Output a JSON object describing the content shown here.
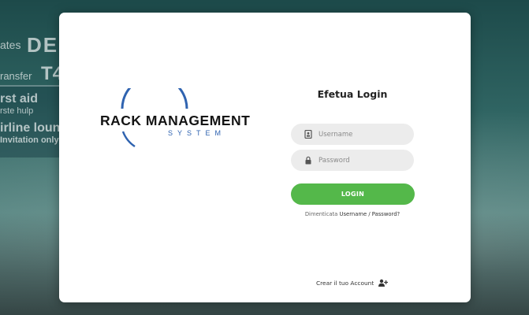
{
  "background": {
    "signs": [
      "ates",
      "DE",
      "ransfer",
      "T4",
      "rst aid",
      "rste hulp",
      "irline loun",
      "Invitation only"
    ]
  },
  "logo": {
    "title": "RACK MANAGEMENT",
    "subtitle": "SYSTEM"
  },
  "login": {
    "title": "Efetua Login",
    "username_placeholder": "Username",
    "password_placeholder": "Password",
    "username_icon": "id-card-icon",
    "password_icon": "lock-icon",
    "button_label": "LOGIN",
    "forgot_prefix": "Dimenticata",
    "forgot_link": "Username / Password?",
    "create_account": "Crear il tuo Account",
    "create_icon": "user-plus-icon"
  },
  "colors": {
    "accent_green": "#54b84a",
    "logo_blue": "#2f63b0",
    "field_bg": "#ececec"
  }
}
